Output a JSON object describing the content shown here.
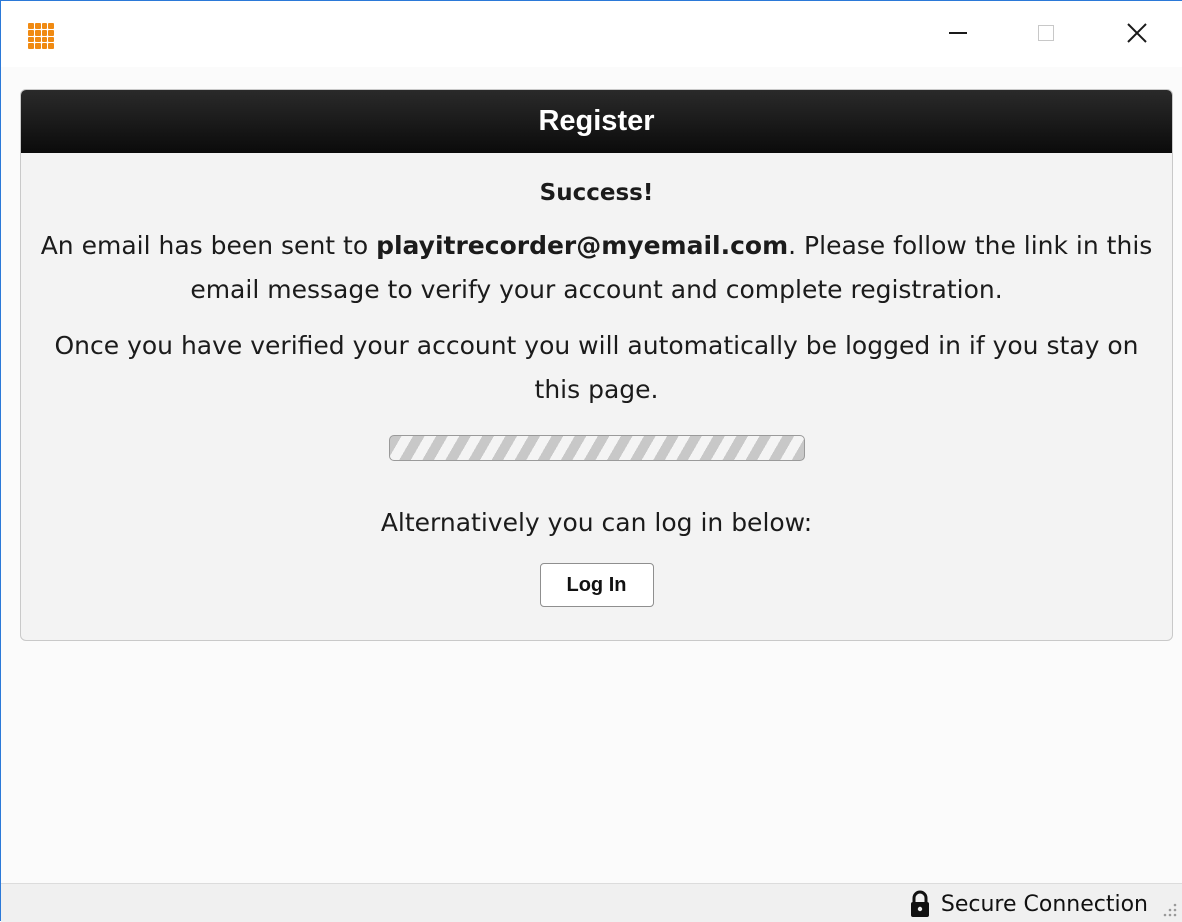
{
  "window": {
    "minimize_label": "–",
    "maximize_label": "□",
    "close_label": "✕"
  },
  "panel": {
    "title": "Register",
    "success_heading": "Success!",
    "message1_prefix": "An email has been sent to ",
    "email": "playitrecorder@myemail.com",
    "message1_suffix": ". Please follow the link in this email message to verify your account and complete registration.",
    "message2": "Once you have verified your account you will automatically be logged in if you stay on this page.",
    "progress": "indeterminate",
    "alternative_text": "Alternatively you can log in below:",
    "login_button": "Log In"
  },
  "statusbar": {
    "secure_label": "Secure Connection"
  },
  "icons": {
    "app": "app-grid-icon",
    "lock": "lock-icon",
    "resize": "resize-grip-icon"
  },
  "colors": {
    "app_icon": "#f08a12",
    "header_bg": "#111111",
    "window_border": "#2b79d8"
  }
}
